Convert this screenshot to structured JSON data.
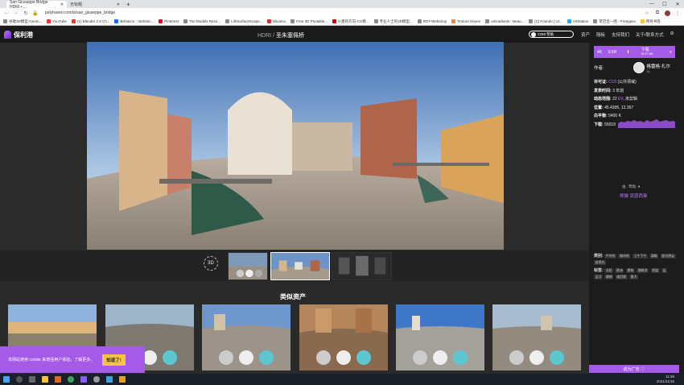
{
  "browser": {
    "tabs": [
      {
        "label": "San Giuseppe Bridge HDRI • ..."
      },
      {
        "label": "无标题"
      }
    ],
    "new_tab": "+",
    "url": "polyhaven.com/a/san_giuseppe_bridge",
    "bookmarks": [
      "谷歌3D模型-Geom...",
      "YouTube",
      "(1) Blender 2.9 Ch...",
      "Behance :: Behanc...",
      "Pinterest",
      "The Models Reso...",
      "LifeSurfaceScape...",
      "Mixamo",
      "Free 3D Printable...",
      "0·建的方向-CG教...",
      "专业人士的3D模型...",
      "RDT-Webshop",
      "Texture Haven",
      "uiGradients - Beau...",
      "[C] Friendo | UI...",
      "ArtStation",
      "苹巴宝一图 - Freeppex",
      "所有书签"
    ]
  },
  "site": {
    "logo_text": "保利港",
    "breadcrumb_prefix": "HDRI / ",
    "breadcrumb_current": "圣朱塞佩桥",
    "donate_label": "2269 赞助",
    "nav": [
      "资产",
      "隔板",
      "支持我们",
      "关于/联系方式"
    ]
  },
  "download": {
    "resolution": "4K",
    "format": "EXR",
    "label": "下载",
    "size": "56.37 MB"
  },
  "author": {
    "label": "作者:",
    "name": "格雷格·扎尔",
    "sub": "By"
  },
  "meta": {
    "license_label": "许可证:",
    "license_value": "CC0",
    "license_note": "(公共领域)",
    "published_label": "发表时间:",
    "published_value": "3 年前",
    "dynamic_label": "动态范围:",
    "dynamic_value": "22",
    "dynamic_ev": "EV",
    "dynamic_note": "未剪辑",
    "location_label": "位置:",
    "location_value": "45.4305, 12.357",
    "whitebalance_label": "白平衡:",
    "whitebalance_value": "5400 K",
    "downloads_label": "下载:",
    "downloads_value": "55019"
  },
  "sponsor": {
    "label": "由...赞助:",
    "link": "熊猫 流感西奥"
  },
  "tags": {
    "categories_label": "类别:",
    "categories": [
      "户外的",
      "城市的",
      "上午下午",
      "清晰",
      "部分阴云",
      "自然光"
    ],
    "tags_label": "标签:",
    "tags": [
      "太阳",
      "欧洲",
      "建筑",
      "建筑学",
      "桥梁",
      "运",
      "运河",
      "晴朗",
      "威尼斯",
      "意大"
    ]
  },
  "similar_title": "类似资产",
  "bottom_banner": "成为广告 ♡",
  "cookie": {
    "text": "本网站使用 cookie 来增强用户体验。了解更多。",
    "button": "知道了!"
  },
  "viewer": {
    "button_3d": "3D"
  },
  "taskbar": {
    "time": "11:38",
    "date": "2021/11/15"
  },
  "colors": {
    "accent": "#a55ae8",
    "link": "#b57cf2",
    "cookie_button": "#f5c542"
  }
}
